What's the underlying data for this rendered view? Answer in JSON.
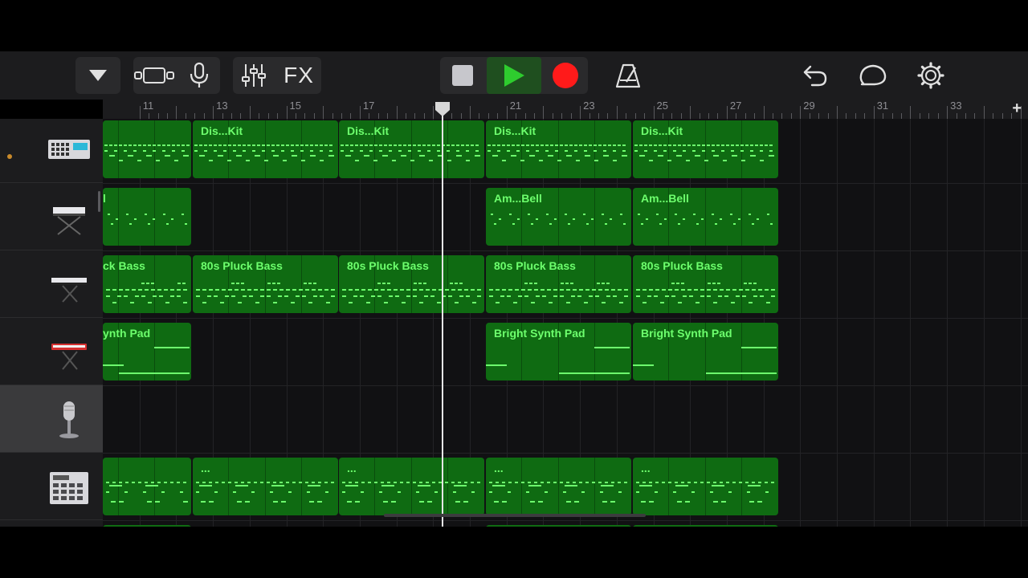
{
  "toolbar": {
    "fx_label": "FX",
    "icons": [
      "track-menu-triangle-icon",
      "views-toggle-icon",
      "microphone-icon",
      "mixer-sliders-icon",
      "stop-icon",
      "play-icon",
      "record-icon",
      "metronome-icon",
      "undo-icon",
      "loop-icon",
      "settings-gear-icon"
    ],
    "colors": {
      "play": "#2ecc2e",
      "record": "#ff1a1a",
      "stop": "#c7c7cc"
    }
  },
  "ruler": {
    "bars": [
      "11",
      "13",
      "15",
      "17",
      "19",
      "21",
      "23",
      "25",
      "27",
      "29",
      "31",
      "33"
    ],
    "add_label": "+"
  },
  "tracks": [
    {
      "instrument": "drum-machine-icon",
      "selected": false,
      "has_indicator": true
    },
    {
      "instrument": "keyboard-stand-icon",
      "selected": false,
      "has_indicator": false
    },
    {
      "instrument": "synth-keyboard-icon",
      "selected": false,
      "has_indicator": false
    },
    {
      "instrument": "red-synth-keyboard-icon",
      "selected": false,
      "has_indicator": false
    },
    {
      "instrument": "microphone-track-icon",
      "selected": true,
      "has_indicator": false
    },
    {
      "instrument": "beat-sequencer-icon",
      "selected": false,
      "has_indicator": false
    }
  ],
  "regions": [
    {
      "track": 0,
      "col": 0,
      "name": ""
    },
    {
      "track": 0,
      "col": 1,
      "name": "Dis...Kit"
    },
    {
      "track": 0,
      "col": 2,
      "name": "Dis...Kit"
    },
    {
      "track": 0,
      "col": 3,
      "name": "Dis...Kit"
    },
    {
      "track": 0,
      "col": 4,
      "name": "Dis...Kit"
    },
    {
      "track": 1,
      "col": 0,
      "name": "l"
    },
    {
      "track": 1,
      "col": 3,
      "name": "Am...Bell"
    },
    {
      "track": 1,
      "col": 4,
      "name": "Am...Bell"
    },
    {
      "track": 2,
      "col": 0,
      "name": "ck Bass"
    },
    {
      "track": 2,
      "col": 1,
      "name": "80s Pluck Bass"
    },
    {
      "track": 2,
      "col": 2,
      "name": "80s Pluck Bass"
    },
    {
      "track": 2,
      "col": 3,
      "name": "80s Pluck Bass"
    },
    {
      "track": 2,
      "col": 4,
      "name": "80s Pluck Bass"
    },
    {
      "track": 3,
      "col": 0,
      "name": "ynth Pad"
    },
    {
      "track": 3,
      "col": 3,
      "name": "Bright Synth Pad"
    },
    {
      "track": 3,
      "col": 4,
      "name": "Bright Synth Pad"
    },
    {
      "track": 5,
      "col": 0,
      "name": ""
    },
    {
      "track": 5,
      "col": 1,
      "name": "..."
    },
    {
      "track": 5,
      "col": 2,
      "name": "..."
    },
    {
      "track": 5,
      "col": 3,
      "name": "..."
    },
    {
      "track": 5,
      "col": 4,
      "name": "..."
    }
  ],
  "playhead_bar": 20
}
